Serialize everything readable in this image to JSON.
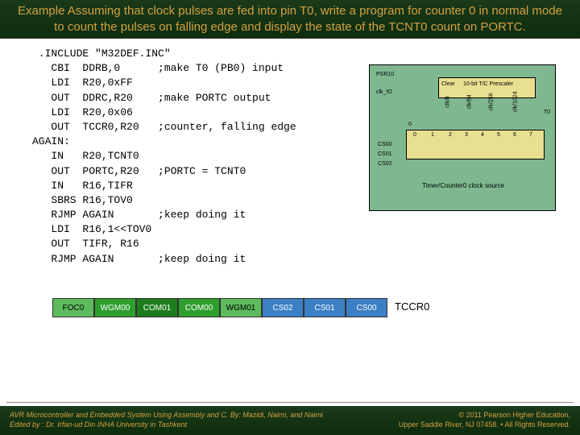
{
  "title": "Example Assuming that clock pulses are fed into pin T0, write a program for counter 0 in normal mode to count the pulses on falling edge and display the state of the TCNT0 count on PORTC.",
  "code": " .INCLUDE \"M32DEF.INC\"\n   CBI  DDRB,0      ;make T0 (PB0) input\n   LDI  R20,0xFF\n   OUT  DDRC,R20    ;make PORTC output\n   LDI  R20,0x06\n   OUT  TCCR0,R20   ;counter, falling edge\nAGAIN:\n   IN   R20,TCNT0\n   OUT  PORTC,R20   ;PORTC = TCNT0\n   IN   R16,TIFR\n   SBRS R16,TOV0\n   RJMP AGAIN       ;keep doing it\n   LDI  R16,1<<TOV0\n   OUT  TIFR, R16\n   RJMP AGAIN       ;keep doing it",
  "diagram": {
    "psr": "PSR10",
    "clk_io": "clk_IO",
    "clear": "Clear",
    "prescaler": "10-bit T/C Prescaler",
    "t0": "T0",
    "cs00": "CS00",
    "cs01": "CS01",
    "cs02": "CS02",
    "bottom": "Timer/Counter0 clock source",
    "v0": "0",
    "v1": "1",
    "v2": "2",
    "v3": "3",
    "v4": "4",
    "v5": "5",
    "v6": "6",
    "v7": "7",
    "c8": "clk/8",
    "c64": "clk/64",
    "c256": "clk/256",
    "c1024": "clk/1024"
  },
  "tccr": {
    "bits": [
      "FOC0",
      "WGM00",
      "COM01",
      "COM00",
      "WGM01",
      "CS02",
      "CS01",
      "CS00"
    ],
    "label": "TCCR0"
  },
  "footer": {
    "book": "AVR Microcontroller and Embedded System Using Assembly and C. By: Mazidi, Naimi, and Naimi",
    "editor": "Edited by : Dr. Irfan-ud Din INHA University in Tashkent",
    "copyright": "© 2011   Pearson Higher Education,",
    "address": "Upper Saddle River, NJ 07458. • All Rights Reserved."
  }
}
